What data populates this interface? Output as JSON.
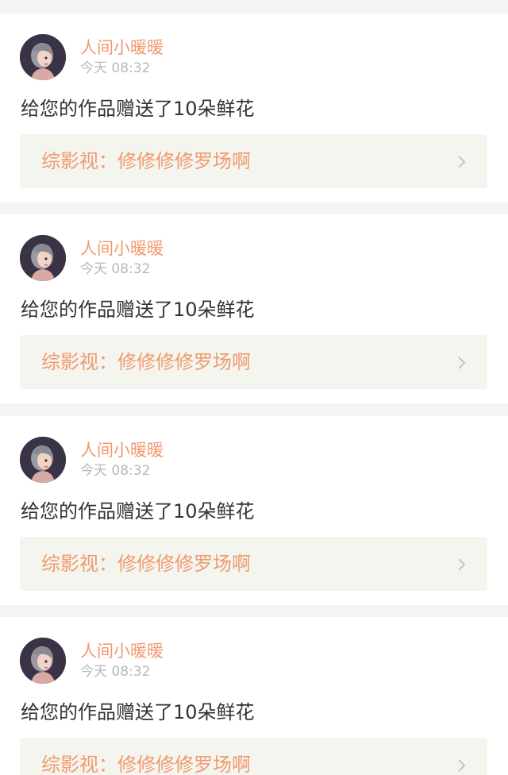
{
  "feed": {
    "items": [
      {
        "username": "人间小暖暖",
        "time": "今天 08:32",
        "message": "给您的作品赠送了10朵鲜花",
        "work_label": "综影视：",
        "work_title": "修修修修罗场啊",
        "avatar_icon": "girl-avatar-icon",
        "chevron_icon": "chevron-right-icon"
      },
      {
        "username": "人间小暖暖",
        "time": "今天 08:32",
        "message": "给您的作品赠送了10朵鲜花",
        "work_label": "综影视：",
        "work_title": "修修修修罗场啊",
        "avatar_icon": "girl-avatar-icon",
        "chevron_icon": "chevron-right-icon"
      },
      {
        "username": "人间小暖暖",
        "time": "今天 08:32",
        "message": "给您的作品赠送了10朵鲜花",
        "work_label": "综影视：",
        "work_title": "修修修修罗场啊",
        "avatar_icon": "girl-avatar-icon",
        "chevron_icon": "chevron-right-icon"
      },
      {
        "username": "人间小暖暖",
        "time": "今天 08:32",
        "message": "给您的作品赠送了10朵鲜花",
        "work_label": "综影视：",
        "work_title": "修修修修罗场啊",
        "avatar_icon": "girl-avatar-icon",
        "chevron_icon": "chevron-right-icon"
      }
    ]
  },
  "colors": {
    "accent": "#ef9a6f",
    "page_background": "#f5f4f2",
    "card_background": "#ffffff",
    "link_background": "#f5f5ef",
    "text_primary": "#333333",
    "text_muted": "#b8b8b8"
  }
}
